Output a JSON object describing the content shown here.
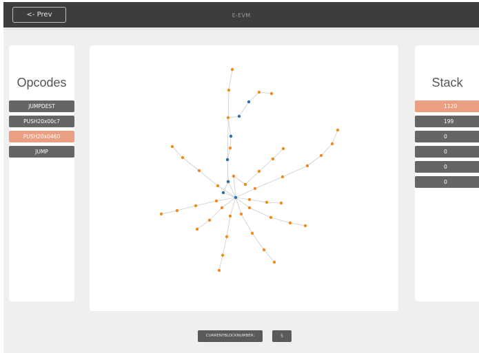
{
  "header": {
    "prev_label": "<- Prev",
    "title": "E-EVM"
  },
  "opcodes": {
    "title": "Opcodes",
    "items": [
      {
        "label": "JUMPDEST",
        "active": false
      },
      {
        "label": "PUSH20x00c7",
        "active": false
      },
      {
        "label": "PUSH20x0460",
        "active": true
      },
      {
        "label": "JUMP",
        "active": false
      }
    ]
  },
  "stack": {
    "title": "Stack",
    "items": [
      "1120",
      "199",
      "0",
      "0",
      "0",
      "0"
    ]
  },
  "footer": {
    "block_label": "CURRENTBLOCKNUMBER:",
    "block_value": "5"
  },
  "colors": {
    "node_visited": "#2a6fad",
    "node_unvisited": "#f08c1e",
    "edge": "#cccccc",
    "highlight": "#eb9f82",
    "button": "#656565"
  }
}
